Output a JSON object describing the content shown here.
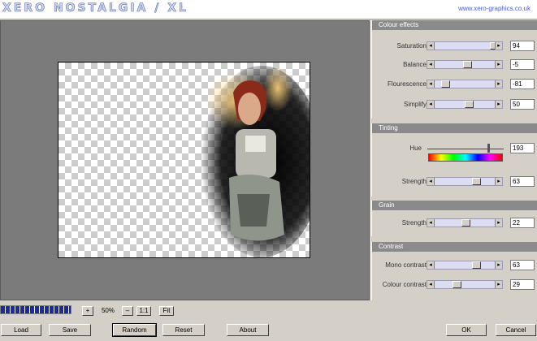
{
  "app": {
    "logo_text": "XERO NOSTALGIA / XL",
    "url": "www.xero-graphics.co.uk"
  },
  "colour_effects": {
    "title": "Colour effects",
    "rows": [
      {
        "label": "Saturation",
        "value": "94",
        "fraction": 0.94
      },
      {
        "label": "Balance",
        "value": "-5",
        "fraction": 0.475
      },
      {
        "label": "Flourescence",
        "value": "-81",
        "fraction": 0.095
      },
      {
        "label": "Simplify",
        "value": "50",
        "fraction": 0.5
      }
    ]
  },
  "tinting": {
    "title": "Tinting",
    "hue_label": "Hue",
    "hue_value": "193",
    "hue_fraction": 0.8,
    "strength_label": "Strength",
    "strength_value": "63",
    "strength_fraction": 0.63
  },
  "grain": {
    "title": "Grain",
    "strength_label": "Strength",
    "strength_value": "22",
    "strength_fraction": 0.45
  },
  "contrast": {
    "title": "Contrast",
    "rows": [
      {
        "label": "Mono contrast",
        "value": "63",
        "fraction": 0.63
      },
      {
        "label": "Colour contrast",
        "value": "29",
        "fraction": 0.29
      }
    ]
  },
  "zoom": {
    "plus": "+",
    "value": "50%",
    "minus": "–",
    "one_to_one": "1:1",
    "fit": "Fit"
  },
  "progress_fraction": 1.0,
  "buttons": {
    "load": "Load",
    "save": "Save",
    "random": "Random",
    "reset": "Reset",
    "about": "About",
    "ok": "OK",
    "cancel": "Cancel"
  },
  "icons": {
    "arrow_left": "left-arrow-icon",
    "arrow_right": "right-arrow-icon"
  }
}
